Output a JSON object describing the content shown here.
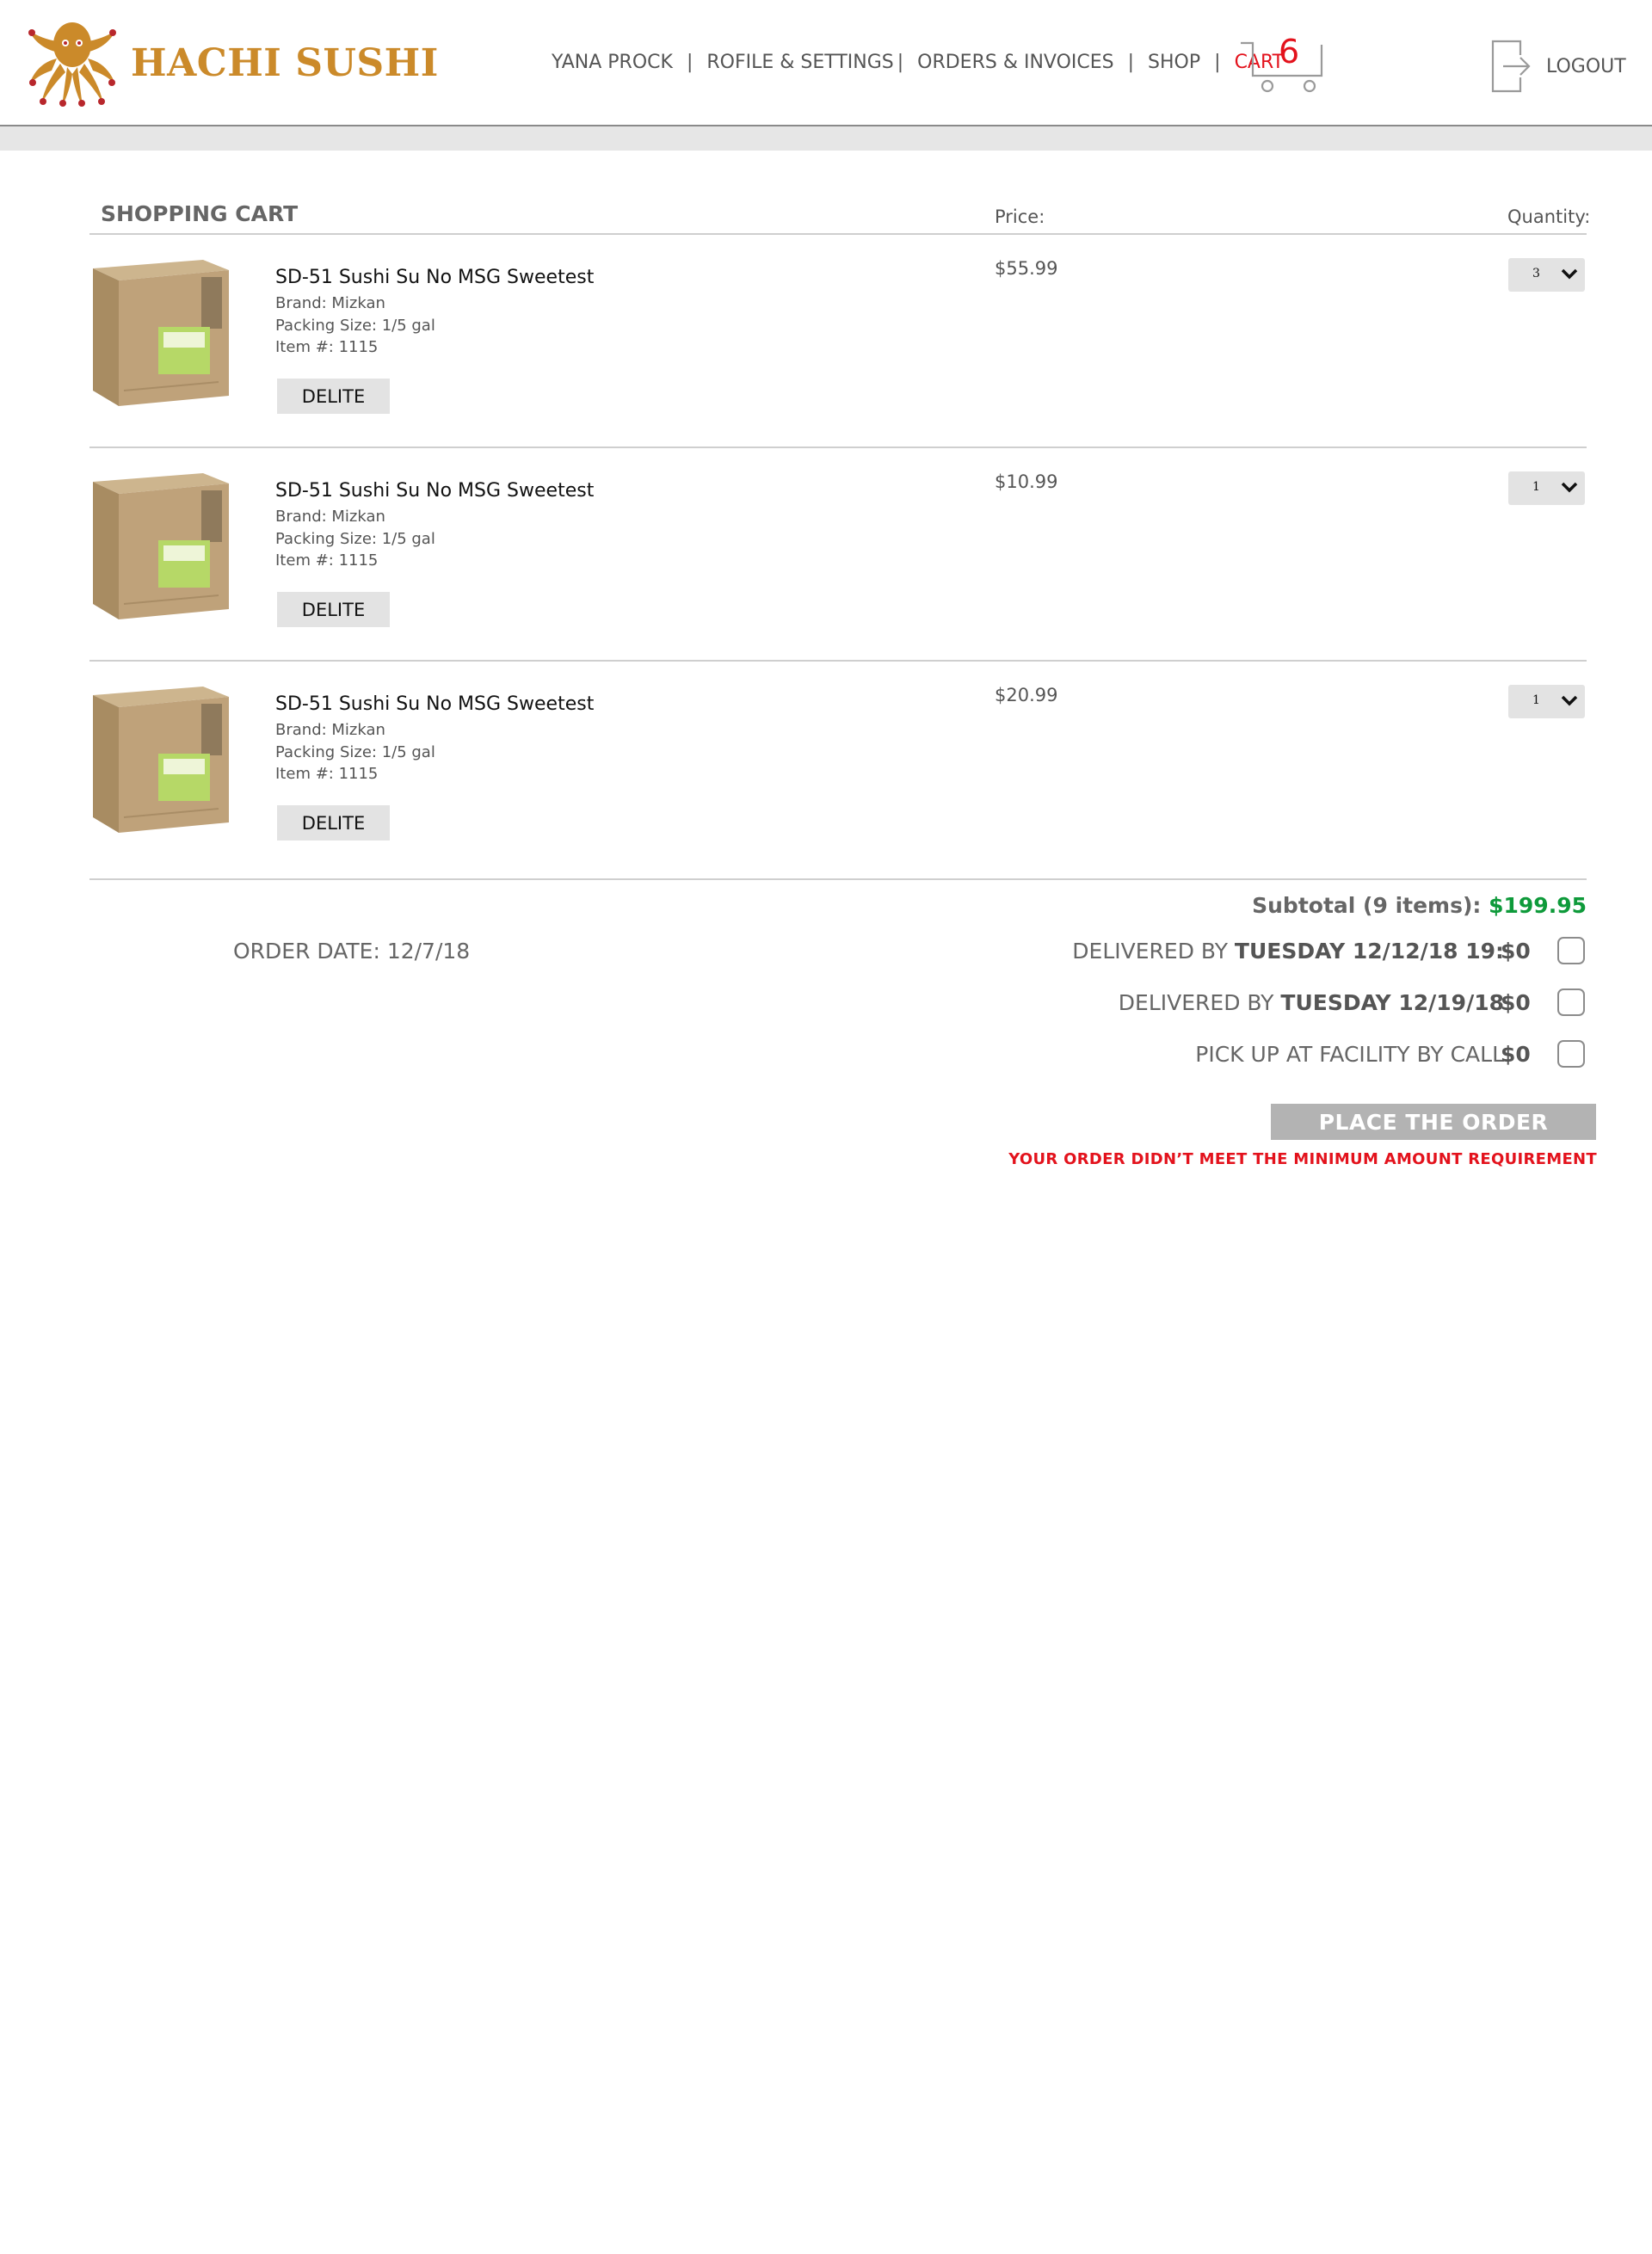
{
  "brand": {
    "name": "HACHI SUSHI",
    "logo_icon": "octopus-logo-icon",
    "color": "#cb8a2a"
  },
  "nav": {
    "user": "YANA PROCK",
    "profile": "ROFILE & SETTINGS",
    "orders": "ORDERS & INVOICES",
    "shop": "SHOP",
    "cart": "CART",
    "cart_count": "6",
    "cart_icon": "shopping-cart-icon",
    "logout": "LOGOUT",
    "logout_icon": "logout-icon"
  },
  "cart": {
    "title": "SHOPPING CART",
    "price_header": "Price:",
    "quantity_header": "Quantity:",
    "items": [
      {
        "name": "SD-51 Sushi Su No MSG Sweetest",
        "brand": "Brand: Mizkan",
        "packing": "Packing Size: 1/5 gal",
        "item_no": "Item #: 1115",
        "price": "$55.99",
        "qty": "3",
        "delete_label": "DELITE"
      },
      {
        "name": "SD-51 Sushi Su No MSG Sweetest",
        "brand": "Brand: Mizkan",
        "packing": "Packing Size: 1/5 gal",
        "item_no": "Item #: 1115",
        "price": "$10.99",
        "qty": "1",
        "delete_label": "DELITE"
      },
      {
        "name": "SD-51 Sushi Su No MSG Sweetest",
        "brand": "Brand: Mizkan",
        "packing": "Packing Size: 1/5 gal",
        "item_no": "Item #: 1115",
        "price": "$20.99",
        "qty": "1",
        "delete_label": "DELITE"
      }
    ]
  },
  "summary": {
    "subtotal_label": "Subtotal (9 items):",
    "subtotal_amount": "$199.95",
    "order_date": "ORDER DATE: 12/7/18",
    "options": [
      {
        "prefix": "DELIVERED BY ",
        "bold": "TUESDAY 12/12/18 19:",
        "fee": "$0",
        "checked": false
      },
      {
        "prefix": "DELIVERED BY ",
        "bold": "TUESDAY 12/19/18",
        "fee": "$0",
        "checked": false
      },
      {
        "prefix": "PICK UP AT FACILITY BY CALL",
        "bold": "",
        "fee": "$0",
        "checked": false
      }
    ],
    "place_order": "PLACE THE ORDER",
    "warning": "YOUR ORDER DIDN’T MEET THE MINIMUM AMOUNT REQUIREMENT"
  },
  "colors": {
    "accent_red": "#e3121c",
    "subtotal_green": "#0e9a3a",
    "button_grey": "#b3b3b3"
  }
}
